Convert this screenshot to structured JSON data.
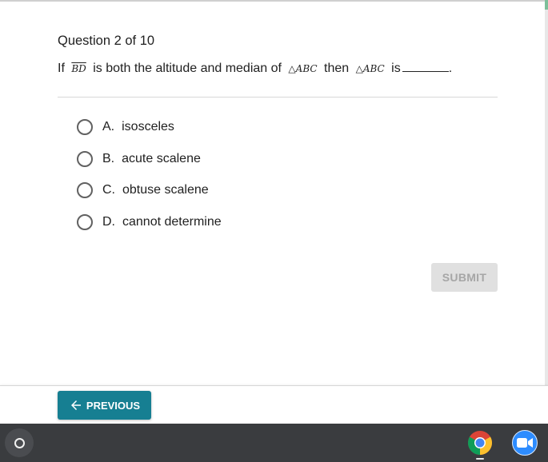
{
  "quiz": {
    "counter": "Question 2 of 10",
    "question": {
      "part1": "If",
      "segment": "BD",
      "part2": "is both the altitude and median of",
      "triangle1": "△ABC",
      "part3": "then",
      "triangle2": "△ABC",
      "part4": "is",
      "end": "."
    },
    "options": [
      {
        "letter": "A.",
        "text": "isosceles",
        "selected": false
      },
      {
        "letter": "B.",
        "text": "acute scalene",
        "selected": false
      },
      {
        "letter": "C.",
        "text": "obtuse scalene",
        "selected": false
      },
      {
        "letter": "D.",
        "text": "cannot determine",
        "selected": false
      }
    ],
    "submit_label": "SUBMIT",
    "submit_enabled": false
  },
  "footer": {
    "previous_label": "PREVIOUS"
  },
  "shelf": {
    "apps": [
      {
        "name": "chrome",
        "icon": "chrome-icon",
        "active": true
      },
      {
        "name": "zoom",
        "icon": "zoom-video-icon",
        "active": false
      }
    ]
  },
  "colors": {
    "accent": "#167f92",
    "submit_disabled_bg": "#e0e0e0",
    "submit_disabled_text": "#a6a6a6",
    "shelf_bg": "#3a3c3f"
  }
}
